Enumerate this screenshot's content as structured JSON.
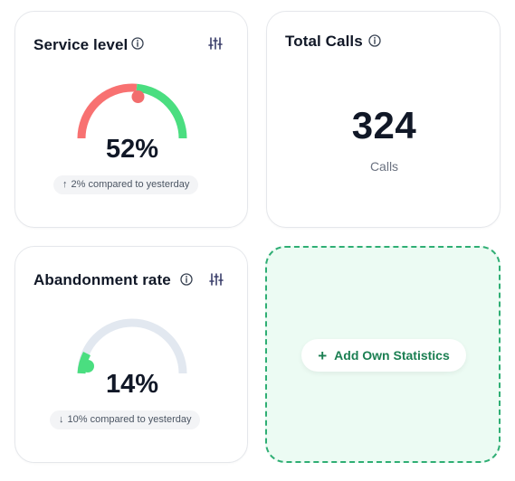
{
  "service_level": {
    "title": "Service level",
    "value_text": "52%",
    "value_fraction": 0.52,
    "comparison_arrow": "↑",
    "comparison_text": "2% compared to yesterday",
    "info_icon": "info-icon",
    "settings_icon": "sliders-icon",
    "colors": {
      "low": "#f87171",
      "high": "#4ade80",
      "marker": "#f26d6d"
    }
  },
  "total_calls": {
    "title": "Total Calls",
    "value": "324",
    "unit": "Calls",
    "info_icon": "info-icon"
  },
  "abandonment_rate": {
    "title": "Abandonment rate",
    "value_text": "14%",
    "value_fraction": 0.14,
    "comparison_arrow": "↓",
    "comparison_text": "10% compared to yesterday",
    "info_icon": "info-icon",
    "settings_icon": "sliders-icon",
    "colors": {
      "track": "#e2e8f0",
      "fill": "#4ade80",
      "marker": "#4ade80"
    }
  },
  "add_statistics": {
    "label": "Add Own Statistics",
    "icon": "plus-icon",
    "colors": {
      "border": "#2fae74",
      "background": "#ecfbf3",
      "text": "#1b7f52"
    }
  }
}
